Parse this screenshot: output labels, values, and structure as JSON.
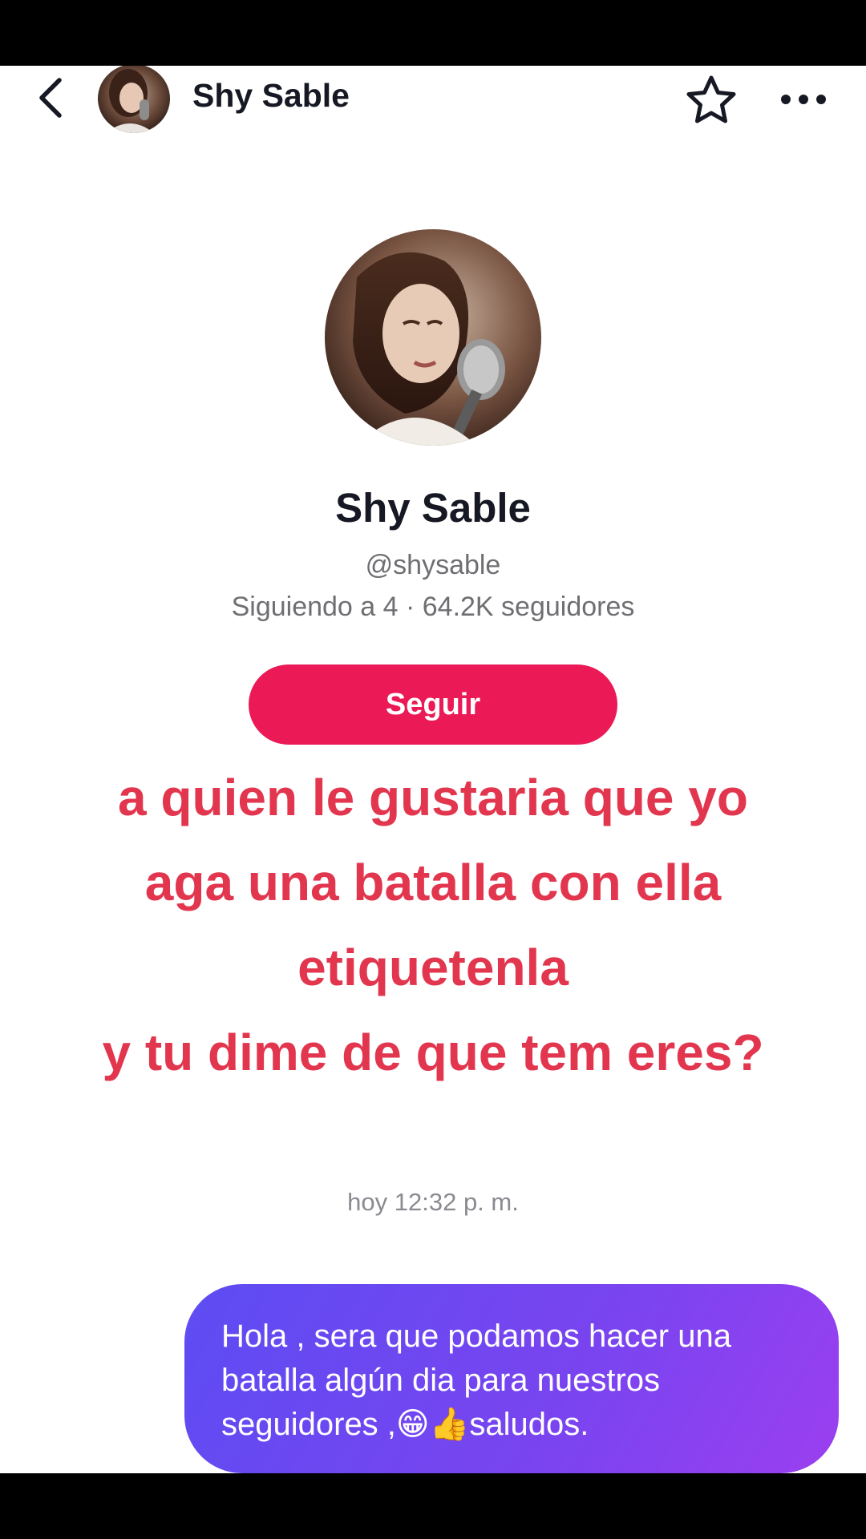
{
  "header": {
    "back_icon": "chevron-left-icon",
    "title": "Shy Sable",
    "star_icon": "star-outline-icon",
    "more_icon": "more-horizontal-icon"
  },
  "profile": {
    "name": "Shy Sable",
    "handle": "@shysable",
    "stats": "Siguiendo a 4 · 64.2K seguidores",
    "follow_label": "Seguir"
  },
  "overlay": {
    "lines": [
      "a quien le gustaria que yo",
      "aga una batalla con ella",
      "etiquetenla",
      "y tu dime de que tem eres?"
    ]
  },
  "chat": {
    "timestamp": "hoy 12:32 p. m.",
    "message_lines": [
      "Hola , sera que podamos hacer una",
      "batalla algún dia para nuestros",
      "seguidores ,😁👍saludos."
    ]
  },
  "colors": {
    "accent": "#eb1a56",
    "overlay_text": "#e2364f",
    "bubble_start": "#5d4cf2",
    "bubble_end": "#9b3ff0"
  }
}
